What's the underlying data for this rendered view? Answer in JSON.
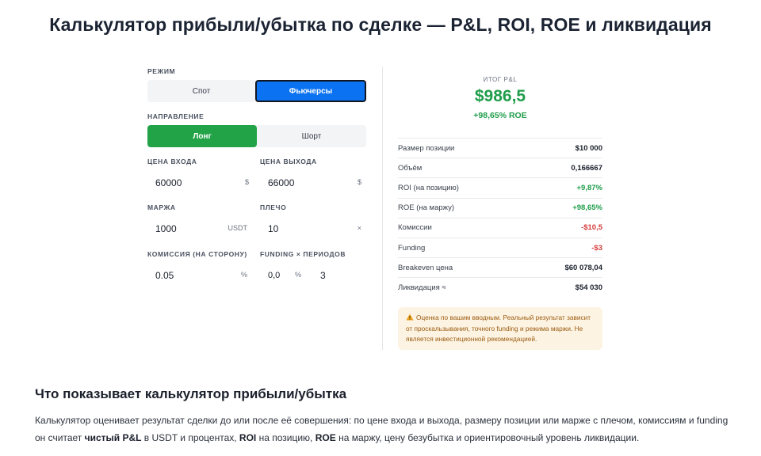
{
  "page_title": "Калькулятор прибыли/убытка по сделке — P&L, ROI, ROE и ликвидация",
  "form": {
    "mode_label": "РЕЖИМ",
    "mode_options": [
      "Спот",
      "Фьючерсы"
    ],
    "mode_selected": "Фьючерсы",
    "direction_label": "НАПРАВЛЕНИЕ",
    "direction_options": [
      "Лонг",
      "Шорт"
    ],
    "direction_selected": "Лонг",
    "entry_label": "ЦЕНА ВХОДА",
    "entry_value": "60000",
    "entry_unit": "$",
    "exit_label": "ЦЕНА ВЫХОДА",
    "exit_value": "66000",
    "exit_unit": "$",
    "margin_label": "МАРЖА",
    "margin_value": "1000",
    "margin_unit": "USDT",
    "leverage_label": "ПЛЕЧО",
    "leverage_value": "10",
    "leverage_unit": "×",
    "fee_label": "КОМИССИЯ (НА СТОРОНУ)",
    "fee_value": "0.05",
    "fee_unit": "%",
    "funding_label": "FUNDING × ПЕРИОДОВ",
    "funding_value": "0,0",
    "funding_unit": "%",
    "periods_value": "3"
  },
  "result": {
    "total_label": "ИТОГ P&L",
    "total_value": "$986,5",
    "total_roe": "+98,65% ROE",
    "metrics": [
      {
        "label": "Размер позиции",
        "value": "$10 000",
        "tone": "neutral"
      },
      {
        "label": "Объём",
        "value": "0,166667",
        "tone": "neutral"
      },
      {
        "label": "ROI (на позицию)",
        "value": "+9,87%",
        "tone": "pos"
      },
      {
        "label": "ROE (на маржу)",
        "value": "+98,65%",
        "tone": "pos"
      },
      {
        "label": "Комиссии",
        "value": "-$10,5",
        "tone": "neg"
      },
      {
        "label": "Funding",
        "value": "-$3",
        "tone": "neg"
      },
      {
        "label": "Breakeven цена",
        "value": "$60 078,04",
        "tone": "neutral"
      },
      {
        "label": "Ликвидация ≈",
        "value": "$54 030",
        "tone": "neutral"
      }
    ],
    "warning_icon": "warning-icon",
    "warning_text": "Оценка по вашим вводным. Реальный результат зависит от проскальзывания, точного funding и режима маржи. Не является инвестиционной рекомендацией."
  },
  "article": {
    "heading": "Что показывает калькулятор прибыли/убытка",
    "p1": "Калькулятор оценивает результат сделки до или после её совершения: по цене входа и выхода, размеру позиции или марже с плечом, комиссиям и funding он считает ",
    "b1": "чистый P&L",
    "p2": " в USDT и процентах, ",
    "b2": "ROI",
    "p3": " на позицию, ",
    "b3": "ROE",
    "p4": " на маржу, цену безубытка и ориентировочный уровень ликвидации."
  },
  "colors": {
    "accent_blue": "#0b72f2",
    "accent_green": "#23a347",
    "positive": "#1f9d4a",
    "negative": "#d63b3b",
    "warning_bg": "#fdf3e3"
  }
}
